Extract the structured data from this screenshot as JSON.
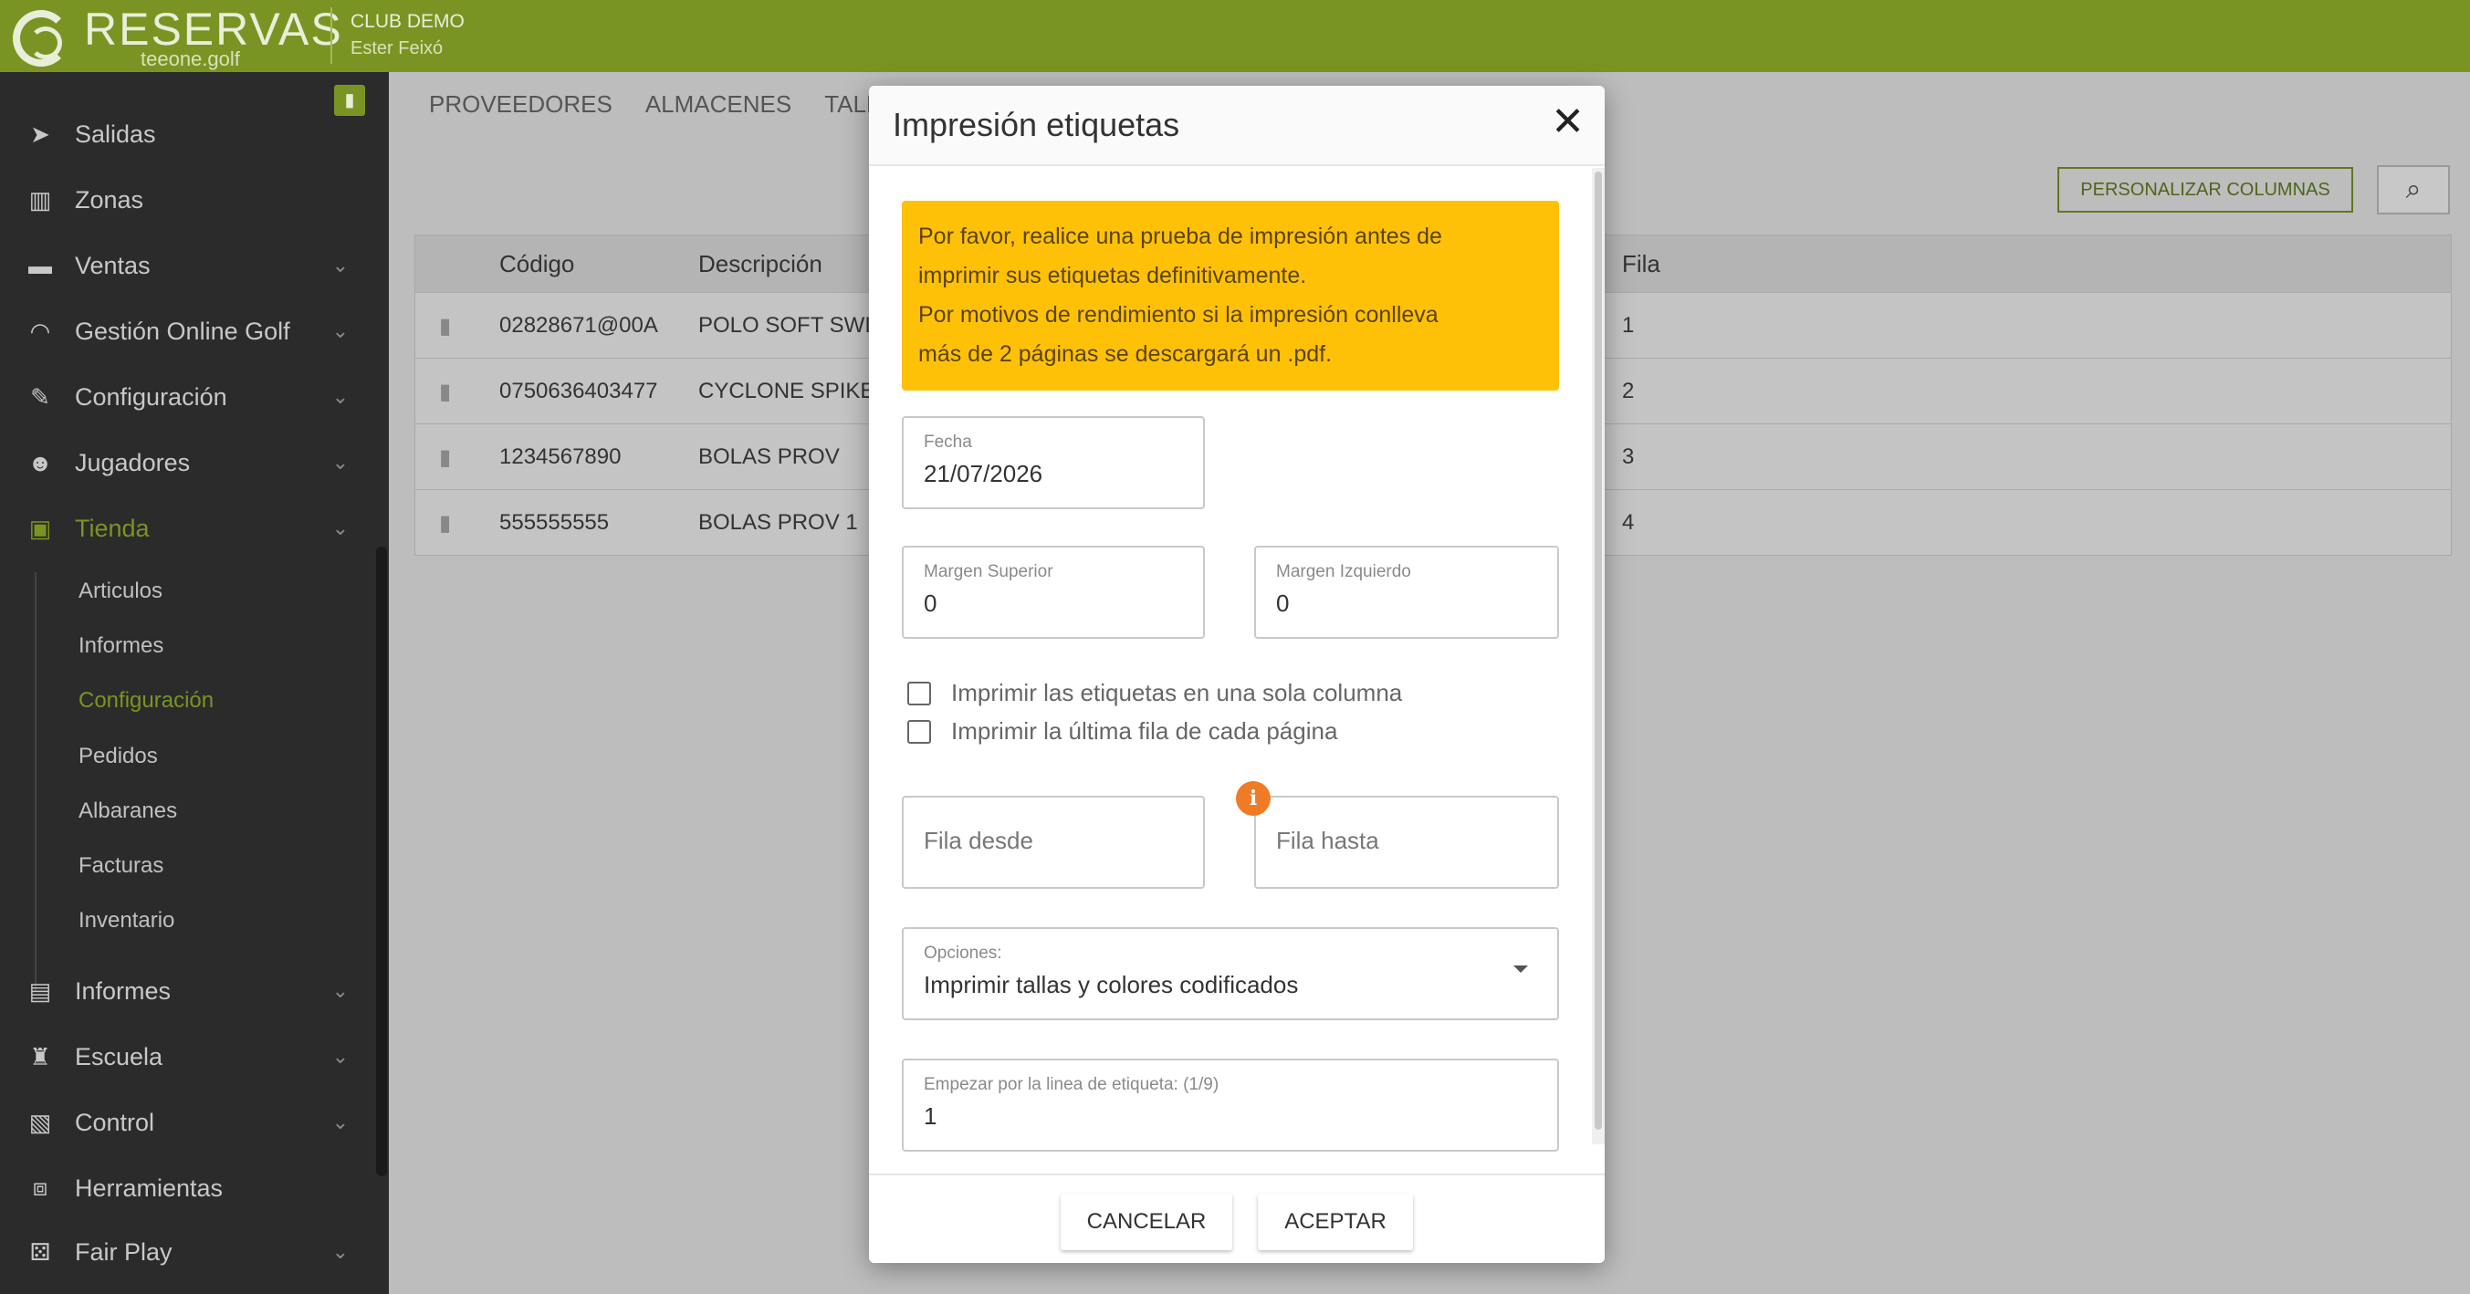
{
  "header": {
    "app_name": "RESERVAS",
    "app_sub": "teeone.golf",
    "club_name": "CLUB DEMO",
    "user_name": "Ester Feixó"
  },
  "sidebar": {
    "items": [
      {
        "label": "Salidas",
        "icon": "send-icon"
      },
      {
        "label": "Zonas",
        "icon": "map-icon"
      },
      {
        "label": "Ventas",
        "icon": "card-icon"
      },
      {
        "label": "Gestión Online Golf",
        "icon": "wifi-icon"
      },
      {
        "label": "Configuración",
        "icon": "wrench-icon"
      },
      {
        "label": "Jugadores",
        "icon": "users-icon"
      },
      {
        "label": "Tienda",
        "icon": "store-icon"
      },
      {
        "label": "Informes",
        "icon": "file-icon"
      },
      {
        "label": "Escuela",
        "icon": "school-icon"
      },
      {
        "label": "Control",
        "icon": "clipboard-icon"
      },
      {
        "label": "Herramientas",
        "icon": "toolbox-icon"
      },
      {
        "label": "Fair Play",
        "icon": "dice-icon"
      }
    ],
    "tienda_sub": [
      "Articulos",
      "Informes",
      "Configuración",
      "Pedidos",
      "Albaranes",
      "Facturas",
      "Inventario"
    ],
    "active_color": "#7a9423"
  },
  "main": {
    "tabs": [
      "PROVEEDORES",
      "ALMACENES",
      "TALL"
    ],
    "customize_columns": "PERSONALIZAR COLUMNAS",
    "table": {
      "headers": {
        "codigo": "Código",
        "descripcion": "Descripción",
        "fila": "Fila"
      },
      "rows": [
        {
          "codigo": "02828671@00A",
          "descripcion": "POLO SOFT SWI",
          "fila": "1"
        },
        {
          "codigo": "0750636403477",
          "descripcion": "CYCLONE SPIKE",
          "fila": "2"
        },
        {
          "codigo": "1234567890",
          "descripcion": "BOLAS PROV",
          "fila": "3"
        },
        {
          "codigo": "555555555",
          "descripcion": "BOLAS PROV 1",
          "fila": "4"
        }
      ]
    }
  },
  "modal": {
    "title": "Impresión etiquetas",
    "warning_line1": "Por favor, realice una prueba de impresión antes de",
    "warning_line2": "imprimir sus etiquetas definitivamente.",
    "warning_line3": "Por motivos de rendimiento si la impresión conlleva",
    "warning_line4": "más de 2 páginas se descargará un .pdf.",
    "warning_color": "#ffc107",
    "fecha_label": "Fecha",
    "fecha_value": "21/07/2026",
    "margen_sup_label": "Margen Superior",
    "margen_sup_value": "0",
    "margen_izq_label": "Margen Izquierdo",
    "margen_izq_value": "0",
    "check_una_columna": "Imprimir las etiquetas en una sola columna",
    "check_ultima_fila": "Imprimir la última fila de cada página",
    "fila_desde_placeholder": "Fila desde",
    "fila_hasta_placeholder": "Fila hasta",
    "opciones_label": "Opciones:",
    "opciones_value": "Imprimir tallas y colores codificados",
    "linea_label": "Empezar por la linea de etiqueta: (1/9)",
    "linea_value": "1",
    "cancel": "CANCELAR",
    "accept": "ACEPTAR"
  }
}
